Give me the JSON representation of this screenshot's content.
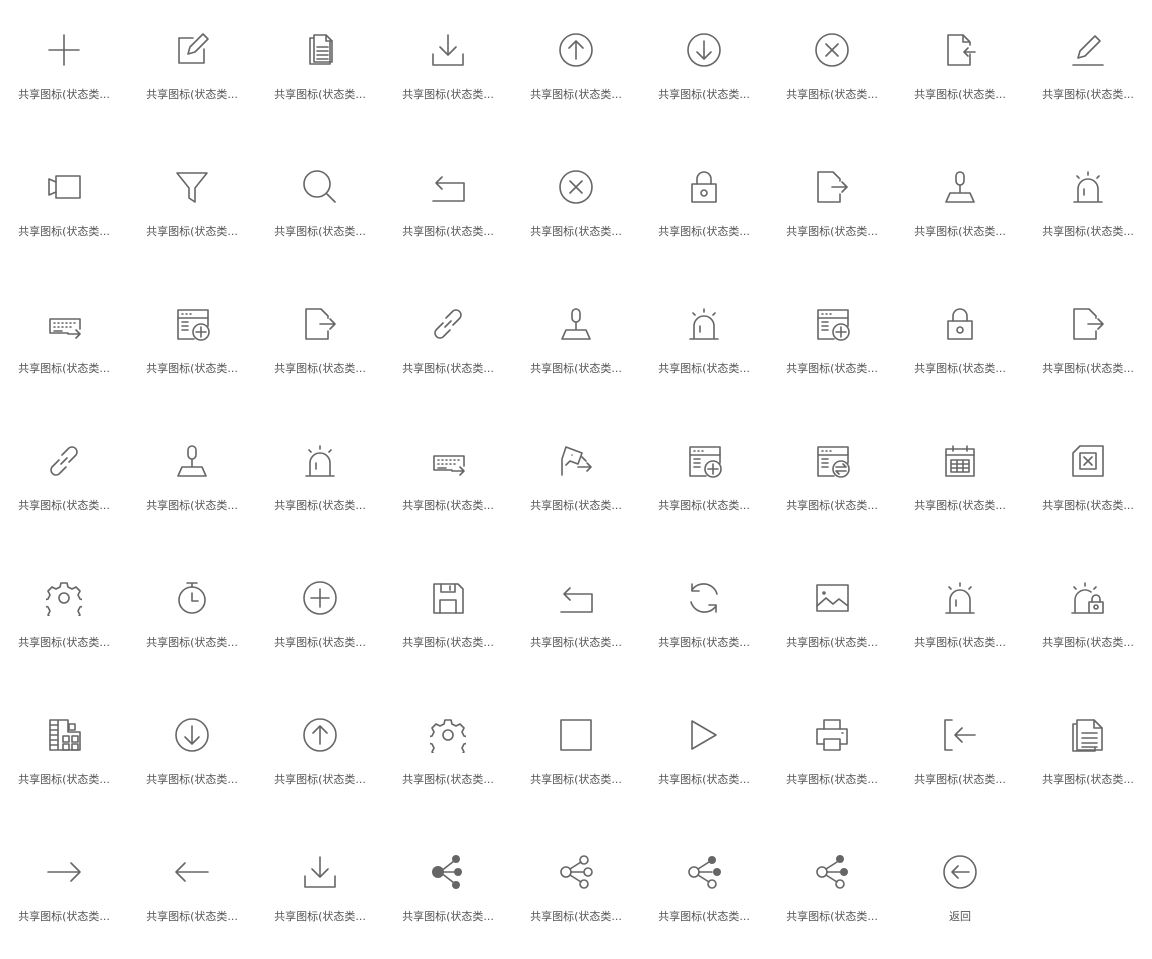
{
  "colors": {
    "icon_stroke": "#666666",
    "label_text": "#555555",
    "background": "#ffffff"
  },
  "icons": [
    {
      "icon": "plus-icon",
      "label": "共享图标(状态类..."
    },
    {
      "icon": "edit-box-icon",
      "label": "共享图标(状态类..."
    },
    {
      "icon": "copy-document-icon",
      "label": "共享图标(状态类..."
    },
    {
      "icon": "download-icon",
      "label": "共享图标(状态类..."
    },
    {
      "icon": "arrow-up-circle-icon",
      "label": "共享图标(状态类..."
    },
    {
      "icon": "arrow-down-circle-icon",
      "label": "共享图标(状态类..."
    },
    {
      "icon": "close-circle-icon",
      "label": "共享图标(状态类..."
    },
    {
      "icon": "file-import-icon",
      "label": "共享图标(状态类..."
    },
    {
      "icon": "pencil-icon",
      "label": "共享图标(状态类..."
    },
    {
      "icon": "video-camera-icon",
      "label": "共享图标(状态类..."
    },
    {
      "icon": "filter-icon",
      "label": "共享图标(状态类..."
    },
    {
      "icon": "search-icon",
      "label": "共享图标(状态类..."
    },
    {
      "icon": "return-icon",
      "label": "共享图标(状态类..."
    },
    {
      "icon": "close-circle-icon",
      "label": "共享图标(状态类..."
    },
    {
      "icon": "lock-icon",
      "label": "共享图标(状态类..."
    },
    {
      "icon": "file-export-icon",
      "label": "共享图标(状态类..."
    },
    {
      "icon": "joystick-icon",
      "label": "共享图标(状态类..."
    },
    {
      "icon": "alarm-light-icon",
      "label": "共享图标(状态类..."
    },
    {
      "icon": "keyboard-arrow-icon",
      "label": "共享图标(状态类..."
    },
    {
      "icon": "form-add-icon",
      "label": "共享图标(状态类..."
    },
    {
      "icon": "file-export-icon",
      "label": "共享图标(状态类..."
    },
    {
      "icon": "link-icon",
      "label": "共享图标(状态类..."
    },
    {
      "icon": "joystick-icon",
      "label": "共享图标(状态类..."
    },
    {
      "icon": "alarm-light-icon",
      "label": "共享图标(状态类..."
    },
    {
      "icon": "form-add-icon",
      "label": "共享图标(状态类..."
    },
    {
      "icon": "lock-icon",
      "label": "共享图标(状态类..."
    },
    {
      "icon": "file-export-icon",
      "label": "共享图标(状态类..."
    },
    {
      "icon": "link-icon",
      "label": "共享图标(状态类..."
    },
    {
      "icon": "joystick-icon",
      "label": "共享图标(状态类..."
    },
    {
      "icon": "alarm-light-icon",
      "label": "共享图标(状态类..."
    },
    {
      "icon": "keyboard-arrow-icon",
      "label": "共享图标(状态类..."
    },
    {
      "icon": "camera-arrow-icon",
      "label": "共享图标(状态类..."
    },
    {
      "icon": "form-add-icon",
      "label": "共享图标(状态类..."
    },
    {
      "icon": "form-switch-icon",
      "label": "共享图标(状态类..."
    },
    {
      "icon": "calendar-grid-icon",
      "label": "共享图标(状态类..."
    },
    {
      "icon": "chip-icon",
      "label": "共享图标(状态类..."
    },
    {
      "icon": "gear-icon",
      "label": "共享图标(状态类..."
    },
    {
      "icon": "stopwatch-icon",
      "label": "共享图标(状态类..."
    },
    {
      "icon": "plus-circle-icon",
      "label": "共享图标(状态类..."
    },
    {
      "icon": "save-icon",
      "label": "共享图标(状态类..."
    },
    {
      "icon": "return-icon",
      "label": "共享图标(状态类..."
    },
    {
      "icon": "refresh-icon",
      "label": "共享图标(状态类..."
    },
    {
      "icon": "image-icon",
      "label": "共享图标(状态类..."
    },
    {
      "icon": "alarm-light-icon",
      "label": "共享图标(状态类..."
    },
    {
      "icon": "alarm-lock-icon",
      "label": "共享图标(状态类..."
    },
    {
      "icon": "film-grid-icon",
      "label": "共享图标(状态类..."
    },
    {
      "icon": "arrow-down-circle-icon",
      "label": "共享图标(状态类..."
    },
    {
      "icon": "arrow-up-circle-icon",
      "label": "共享图标(状态类..."
    },
    {
      "icon": "gear-icon",
      "label": "共享图标(状态类..."
    },
    {
      "icon": "square-icon",
      "label": "共享图标(状态类..."
    },
    {
      "icon": "play-icon",
      "label": "共享图标(状态类..."
    },
    {
      "icon": "printer-icon",
      "label": "共享图标(状态类..."
    },
    {
      "icon": "login-icon",
      "label": "共享图标(状态类..."
    },
    {
      "icon": "document-icon",
      "label": "共享图标(状态类..."
    },
    {
      "icon": "arrow-right-icon",
      "label": "共享图标(状态类..."
    },
    {
      "icon": "arrow-left-icon",
      "label": "共享图标(状态类..."
    },
    {
      "icon": "download-icon",
      "label": "共享图标(状态类..."
    },
    {
      "icon": "share-filled-icon",
      "label": "共享图标(状态类..."
    },
    {
      "icon": "share-icon",
      "label": "共享图标(状态类..."
    },
    {
      "icon": "share-right-filled-icon",
      "label": "共享图标(状态类..."
    },
    {
      "icon": "share-half-filled-icon",
      "label": "共享图标(状态类..."
    },
    {
      "icon": "back-circle-icon",
      "label": "返回"
    }
  ]
}
